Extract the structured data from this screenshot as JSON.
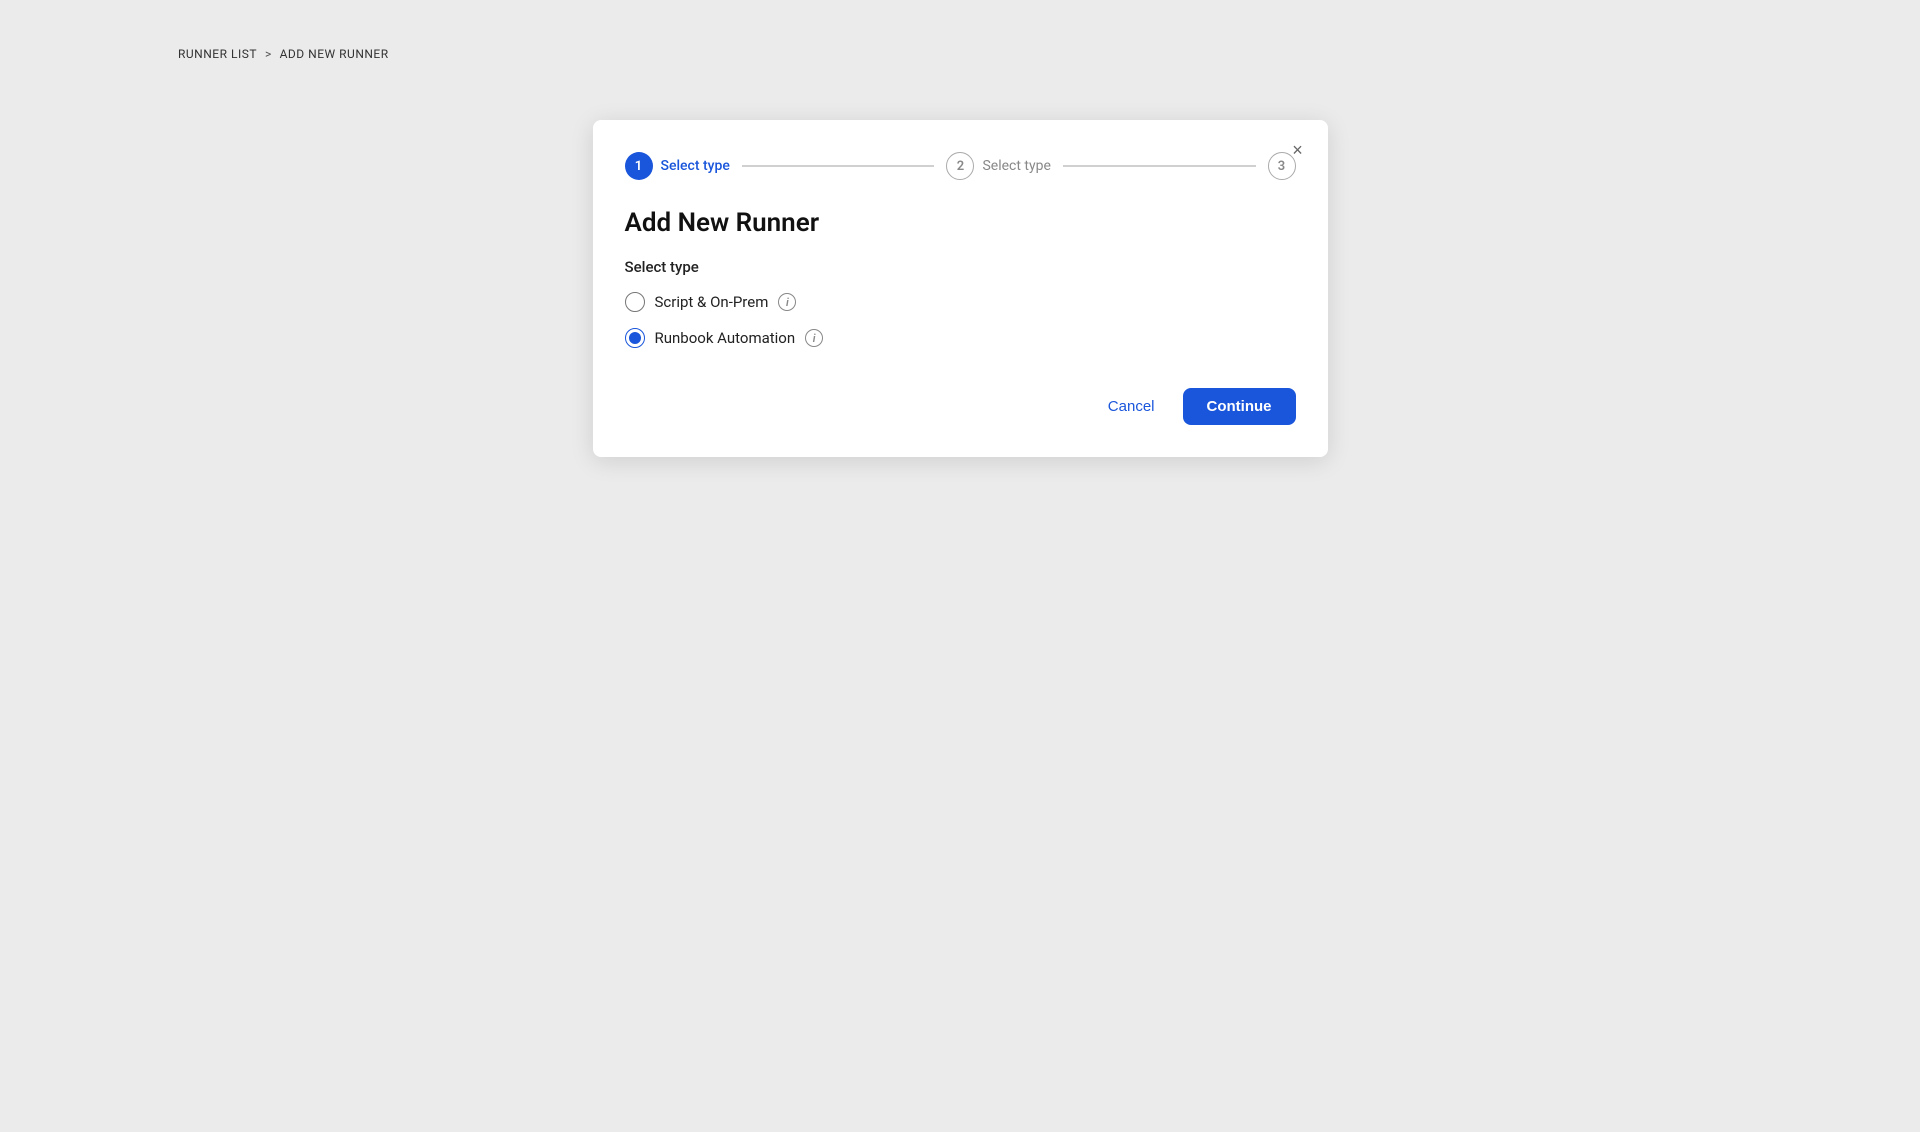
{
  "breadcrumb": {
    "parent_label": "RUNNER LIST",
    "separator": ">",
    "current_label": "ADD NEW RUNNER"
  },
  "dialog": {
    "close_icon": "×",
    "title": "Add New Runner",
    "stepper": {
      "steps": [
        {
          "number": "1",
          "label": "Select type",
          "active": true
        },
        {
          "number": "2",
          "label": "Select type",
          "active": false
        },
        {
          "number": "3",
          "label": "",
          "active": false
        }
      ]
    },
    "section_label": "Select type",
    "options": [
      {
        "id": "script",
        "label": "Script & On-Prem",
        "checked": false
      },
      {
        "id": "runbook",
        "label": "Runbook Automation",
        "checked": true
      }
    ],
    "info_icon_label": "i",
    "footer": {
      "cancel_label": "Cancel",
      "continue_label": "Continue"
    }
  },
  "colors": {
    "accent": "#1a56db",
    "bg": "#ebebeb",
    "dialog_bg": "#ffffff"
  }
}
